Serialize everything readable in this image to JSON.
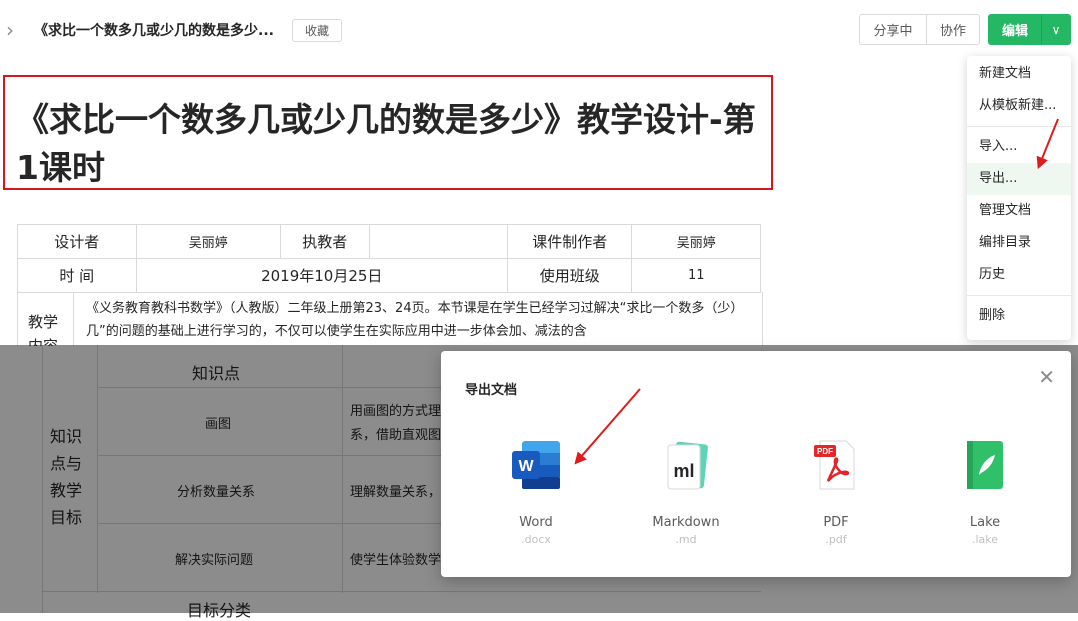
{
  "header": {
    "doc_title": "《求比一个数多几或少几的数是多少...",
    "favorite": "收藏",
    "share": "分享中",
    "collab": "协作",
    "edit": "编辑"
  },
  "document": {
    "title": "《求比一个数多几或少几的数是多少》教学设计-第1课时",
    "table": {
      "row1": [
        "设计者",
        "吴丽婷",
        "执教者",
        "",
        "课件制作者",
        "吴丽婷"
      ],
      "row2": [
        "时  间",
        "2019年10月25日",
        "使用班级",
        "11"
      ],
      "row3_label": "教学内容",
      "row3_text": "《义务教育教科书数学》（人教版）二年级上册第23、24页。本节课是在学生已经学习过解决“求比一个数多（少）几”的问题的基础上进行学习的，不仅可以使学生在实际应用中进一步体会加、减法的含",
      "section_label": "知识点与教学目标",
      "col_header": "知识点",
      "rows": [
        {
          "point": "画图",
          "target": "用画图的方式理",
          "target2": "系，借助直观图"
        },
        {
          "point": "分析数量关系",
          "target": "理解数量关系，"
        },
        {
          "point": "解决实际问题",
          "target": "使学生体验数学"
        }
      ],
      "bottom_label": "目标分类"
    }
  },
  "menu": {
    "items": [
      "新建文档",
      "从模板新建...",
      "导入...",
      "导出...",
      "管理文档",
      "编排目录",
      "历史",
      "删除"
    ]
  },
  "modal": {
    "title": "导出文档",
    "options": [
      {
        "name": "Word",
        "ext": ".docx"
      },
      {
        "name": "Markdown",
        "ext": ".md"
      },
      {
        "name": "PDF",
        "ext": ".pdf"
      },
      {
        "name": "Lake",
        "ext": ".lake"
      }
    ]
  },
  "colors": {
    "accent": "#25b864",
    "highlight": "#d9141a"
  }
}
